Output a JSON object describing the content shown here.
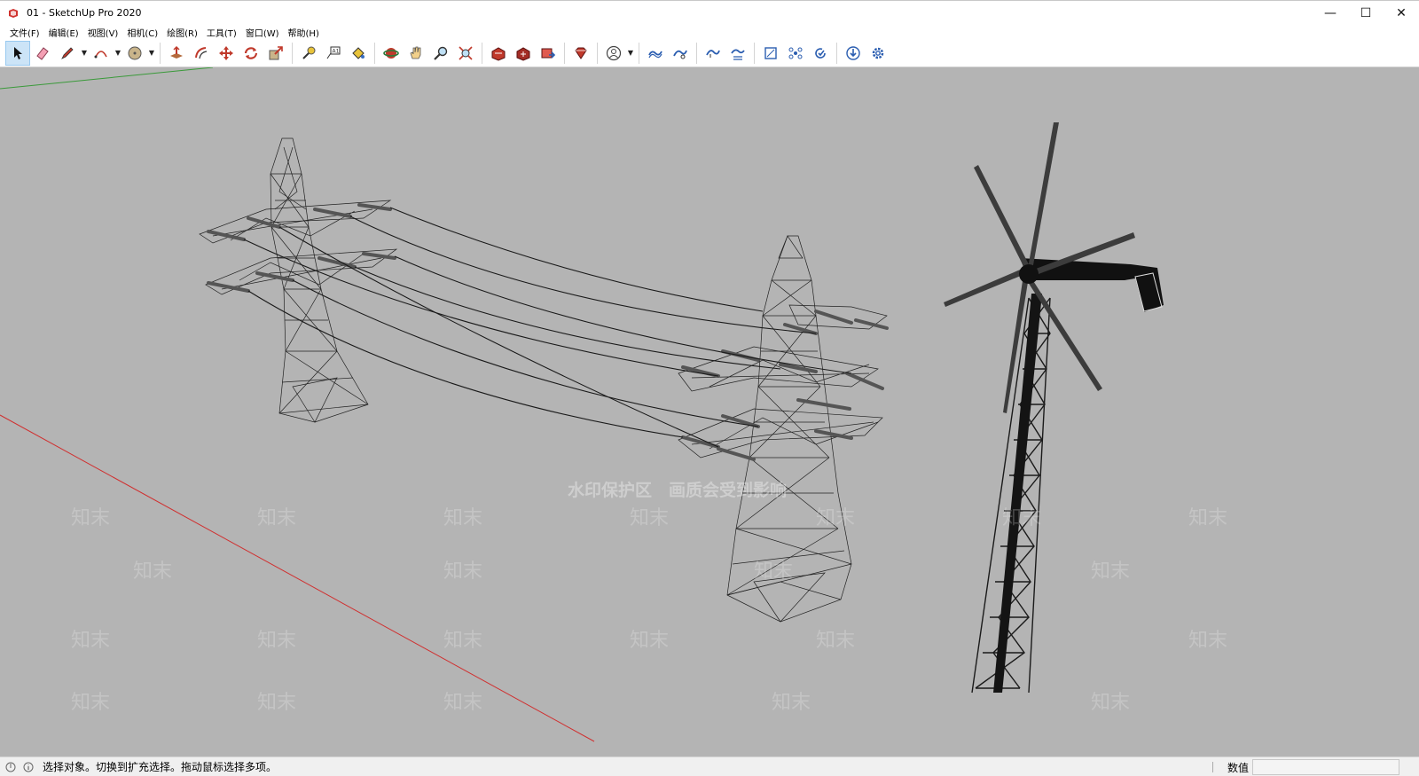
{
  "window": {
    "title": "01 - SketchUp Pro 2020",
    "controls": {
      "minimize": "—",
      "maximize": "☐",
      "close": "✕"
    }
  },
  "menu": [
    {
      "label": "文件(F)"
    },
    {
      "label": "编辑(E)"
    },
    {
      "label": "视图(V)"
    },
    {
      "label": "相机(C)"
    },
    {
      "label": "绘图(R)"
    },
    {
      "label": "工具(T)"
    },
    {
      "label": "窗口(W)"
    },
    {
      "label": "帮助(H)"
    }
  ],
  "toolbar": {
    "tools": [
      {
        "name": "select-tool-button",
        "icon": "arrow-cursor-icon",
        "active": true
      },
      {
        "name": "eraser-tool-button",
        "icon": "eraser-icon"
      },
      {
        "name": "line-tool-button",
        "icon": "pencil-icon",
        "dropdown": true
      },
      {
        "name": "arc-tool-button",
        "icon": "arc-icon",
        "dropdown": true
      },
      {
        "name": "shape-tool-button",
        "icon": "circle-shape-icon",
        "dropdown": true
      },
      {
        "name": "push-pull-tool-button",
        "icon": "push-pull-icon"
      },
      {
        "name": "offset-tool-button",
        "icon": "offset-icon"
      },
      {
        "name": "move-tool-button",
        "icon": "move-icon"
      },
      {
        "name": "rotate-tool-button",
        "icon": "rotate-icon"
      },
      {
        "name": "scale-tool-button",
        "icon": "scale-icon"
      },
      {
        "name": "tape-measure-tool-button",
        "icon": "tape-measure-icon"
      },
      {
        "name": "text-tool-button",
        "icon": "text-label-icon"
      },
      {
        "name": "paint-bucket-tool-button",
        "icon": "paint-bucket-icon"
      },
      {
        "name": "orbit-tool-button",
        "icon": "orbit-icon"
      },
      {
        "name": "pan-tool-button",
        "icon": "hand-icon"
      },
      {
        "name": "zoom-tool-button",
        "icon": "magnifier-icon"
      },
      {
        "name": "zoom-extents-button",
        "icon": "zoom-extents-icon"
      },
      {
        "name": "warehouse-button",
        "icon": "warehouse-icon"
      },
      {
        "name": "share-model-button",
        "icon": "share-model-icon"
      },
      {
        "name": "send-to-layout-button",
        "icon": "layout-icon"
      },
      {
        "name": "extension-warehouse-button",
        "icon": "ruby-gem-icon"
      },
      {
        "name": "account-button",
        "icon": "user-account-icon",
        "dropdown": true
      },
      {
        "name": "sandbox-from-contours-button",
        "icon": "sandbox-contours-icon"
      },
      {
        "name": "sandbox-from-scratch-button",
        "icon": "sandbox-scratch-icon"
      },
      {
        "name": "smoove-button",
        "icon": "smoove-icon"
      },
      {
        "name": "stamp-button",
        "icon": "stamp-icon"
      },
      {
        "name": "drape-button",
        "icon": "drape-icon"
      },
      {
        "name": "add-detail-button",
        "icon": "add-detail-icon"
      },
      {
        "name": "flip-edge-button",
        "icon": "flip-edge-icon"
      },
      {
        "name": "download-button",
        "icon": "download-icon"
      },
      {
        "name": "settings-button",
        "icon": "gear-icon"
      }
    ],
    "dropdown_glyph": "▼"
  },
  "viewport": {
    "background": "#b4b4b4",
    "axis_colors": {
      "red": "#d03030",
      "green": "#3a9a3a"
    },
    "watermark": {
      "banner": "水印保护区　画质会受到影响",
      "tile": "知末"
    }
  },
  "status": {
    "message": "选择对象。切换到扩充选择。拖动鼠标选择多项。",
    "value_label": "数值",
    "value": "",
    "icons": {
      "geo": "geo-location-icon",
      "info": "info-icon"
    }
  }
}
